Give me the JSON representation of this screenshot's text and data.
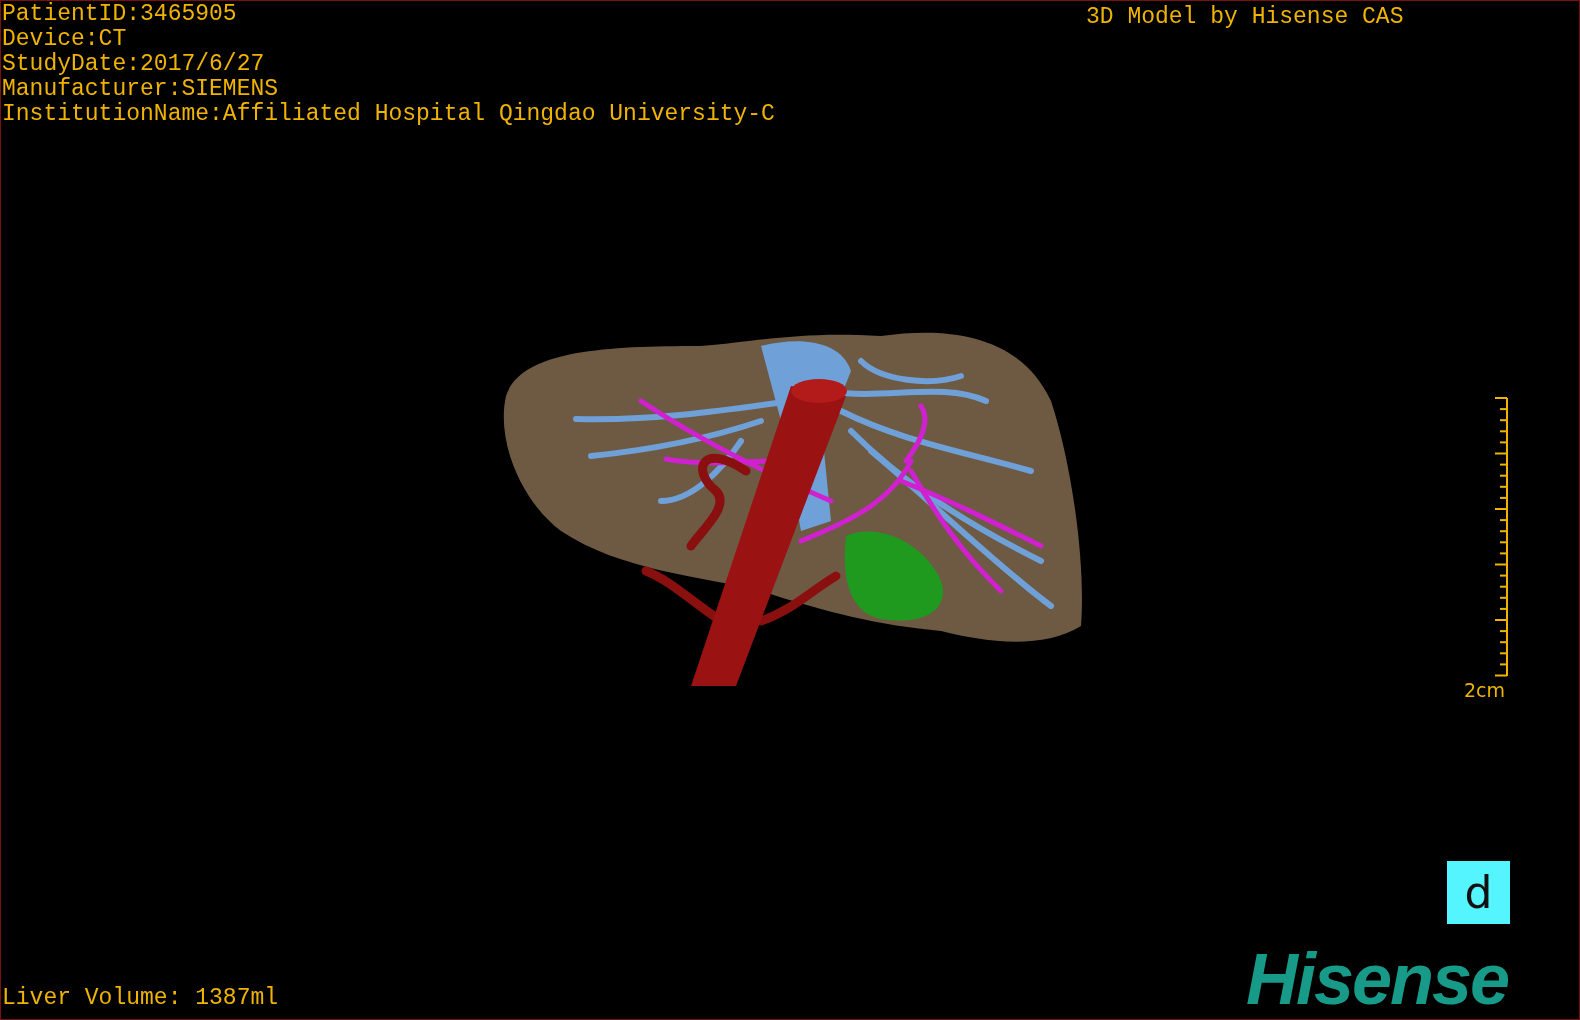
{
  "study_info": [
    "PatientID:3465905",
    "Device:CT",
    "StudyDate:2017/6/27",
    "Manufacturer:SIEMENS",
    "InstitutionName:Affiliated Hospital Qingdao University-C"
  ],
  "model_credit": "3D Model by Hisense CAS",
  "scale_bar": {
    "label": "2cm"
  },
  "view_button": {
    "label": "d"
  },
  "logo": "Hisense",
  "liver_volume": "Liver Volume: 1387ml"
}
